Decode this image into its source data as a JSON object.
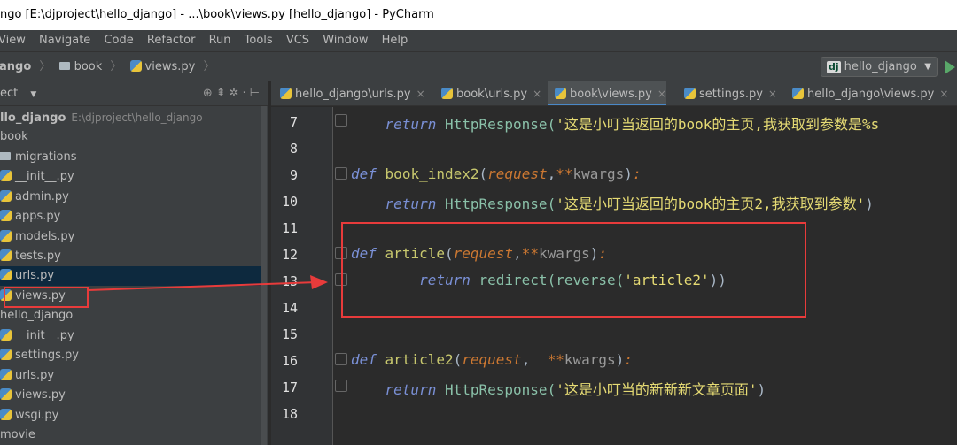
{
  "window": {
    "title": "ngo [E:\\djproject\\hello_django] - ...\\book\\views.py [hello_django] - PyCharm"
  },
  "menu": [
    "View",
    "Navigate",
    "Code",
    "Refactor",
    "Run",
    "Tools",
    "VCS",
    "Window",
    "Help"
  ],
  "breadcrumb": {
    "project": "ango",
    "folder": "book",
    "file": "views.py"
  },
  "run_config": {
    "badge": "dj",
    "name": "hello_django"
  },
  "project_panel": {
    "header": "ect",
    "root_label": "llo_django",
    "root_path": "E:\\djproject\\hello_django",
    "items": [
      "book",
      "migrations",
      "__init__.py",
      "admin.py",
      "apps.py",
      "models.py",
      "tests.py",
      "urls.py",
      "views.py",
      "hello_django",
      "__init__.py",
      "settings.py",
      "urls.py",
      "views.py",
      "wsgi.py",
      "movie"
    ]
  },
  "tabs": [
    {
      "label": "hello_django\\urls.py",
      "active": false
    },
    {
      "label": "book\\urls.py",
      "active": false
    },
    {
      "label": "book\\views.py",
      "active": true
    },
    {
      "label": "settings.py",
      "active": false
    },
    {
      "label": "hello_django\\views.py",
      "active": false
    }
  ],
  "code_lines": [
    {
      "num": "7"
    },
    {
      "num": "8"
    },
    {
      "num": "9"
    },
    {
      "num": "10"
    },
    {
      "num": "11"
    },
    {
      "num": "12"
    },
    {
      "num": "13"
    },
    {
      "num": "14"
    },
    {
      "num": "15"
    },
    {
      "num": "16"
    },
    {
      "num": "17"
    },
    {
      "num": "18"
    }
  ],
  "code": {
    "l7_kw": "return",
    "l7_call": "HttpResponse(",
    "l7_str": "'这是小叮当返回的book的主页,我获取到参数是%s",
    "l9_def": "def",
    "l9_name": "book_index2",
    "l9_params": "request",
    "l9_kwargs": "kwargs",
    "l10_kw": "return",
    "l10_call": "HttpResponse(",
    "l10_str": "'这是小叮当返回的book的主页2,我获取到参数'",
    "l12_def": "def",
    "l12_name": "article",
    "l12_params": "request",
    "l12_kwargs": "kwargs",
    "l13_kw": "return",
    "l13_call": "redirect(reverse(",
    "l13_str": "'article2'",
    "l16_def": "def",
    "l16_name": "article2",
    "l16_params": "request",
    "l16_kwargs": "kwargs",
    "l17_kw": "return",
    "l17_call": "HttpResponse(",
    "l17_str": "'这是小叮当的新新新文章页面'"
  },
  "colors": {
    "annotation": "#e83b3b",
    "selection": "#0d293e",
    "tab_underline": "#4a88c7"
  }
}
